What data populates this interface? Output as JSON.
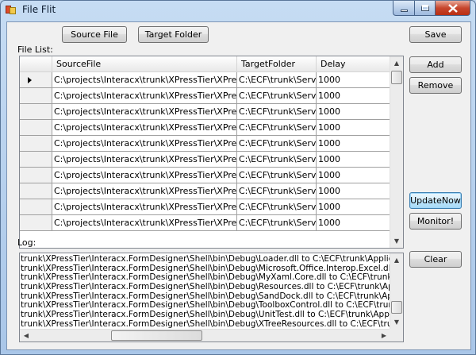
{
  "window": {
    "title": "File Flit"
  },
  "toolbar": {
    "source_file_label": "Source File",
    "target_folder_label": "Target Folder"
  },
  "labels": {
    "file_list": "File List:",
    "log": "Log:"
  },
  "buttons": {
    "save": "Save",
    "add": "Add",
    "remove": "Remove",
    "update_now": "UpdateNow",
    "monitor": "Monitor!",
    "clear": "Clear"
  },
  "grid": {
    "columns": [
      "SourceFile",
      "TargetFolder",
      "Delay"
    ],
    "rows": [
      [
        "C:\\projects\\Interacx\\trunk\\XPressTier\\XPressTier....",
        "C:\\ECF\\trunk\\Server",
        "1000"
      ],
      [
        "C:\\projects\\Interacx\\trunk\\XPressTier\\XPressTier....",
        "C:\\ECF\\trunk\\Server",
        "1000"
      ],
      [
        "C:\\projects\\Interacx\\trunk\\XPressTier\\XPressTier....",
        "C:\\ECF\\trunk\\Server",
        "1000"
      ],
      [
        "C:\\projects\\Interacx\\trunk\\XPressTier\\XPressTier....",
        "C:\\ECF\\trunk\\Server",
        "1000"
      ],
      [
        "C:\\projects\\Interacx\\trunk\\XPressTier\\XPressTier....",
        "C:\\ECF\\trunk\\Server",
        "1000"
      ],
      [
        "C:\\projects\\Interacx\\trunk\\XPressTier\\XPressTier....",
        "C:\\ECF\\trunk\\Server",
        "1000"
      ],
      [
        "C:\\projects\\Interacx\\trunk\\XPressTier\\XPressTier....",
        "C:\\ECF\\trunk\\Server",
        "1000"
      ],
      [
        "C:\\projects\\Interacx\\trunk\\XPressTier\\XPressTier....",
        "C:\\ECF\\trunk\\Server",
        "1000"
      ],
      [
        "C:\\projects\\Interacx\\trunk\\XPressTier\\XPressTier....",
        "C:\\ECF\\trunk\\Server",
        "1000"
      ],
      [
        "C:\\projects\\Interacx\\trunk\\XPressTier\\XPressTier....",
        "C:\\ECF\\trunk\\Server",
        "1000"
      ]
    ]
  },
  "log": {
    "lines": [
      "trunk\\XPressTier\\Interacx.FormDesigner\\Shell\\bin\\Debug\\Loader.dll to C:\\ECF\\trunk\\Application Developme",
      "trunk\\XPressTier\\Interacx.FormDesigner\\Shell\\bin\\Debug\\Microsoft.Office.Interop.Excel.dll to C:\\ECF\\trunk\\",
      "trunk\\XPressTier\\Interacx.FormDesigner\\Shell\\bin\\Debug\\MyXaml.Core.dll to C:\\ECF\\trunk\\Application Deve",
      "trunk\\XPressTier\\Interacx.FormDesigner\\Shell\\bin\\Debug\\Resources.dll to C:\\ECF\\trunk\\Application Develo",
      "trunk\\XPressTier\\Interacx.FormDesigner\\Shell\\bin\\Debug\\SandDock.dll to C:\\ECF\\trunk\\Application Develo",
      "trunk\\XPressTier\\Interacx.FormDesigner\\Shell\\bin\\Debug\\ToolboxControl.dll to C:\\ECF\\trunk\\Application De",
      "trunk\\XPressTier\\Interacx.FormDesigner\\Shell\\bin\\Debug\\UnitTest.dll to C:\\ECF\\trunk\\Application Developm",
      "trunk\\XPressTier\\Interacx.FormDesigner\\Shell\\bin\\Debug\\XTreeResources.dll to C:\\ECF\\trunk\\Application D"
    ]
  },
  "icons": {
    "row_pointer": "row-pointer-icon",
    "scroll_up": "scroll-up-icon",
    "scroll_down": "scroll-down-icon",
    "scroll_left": "scroll-left-icon",
    "scroll_right": "scroll-right-icon"
  }
}
